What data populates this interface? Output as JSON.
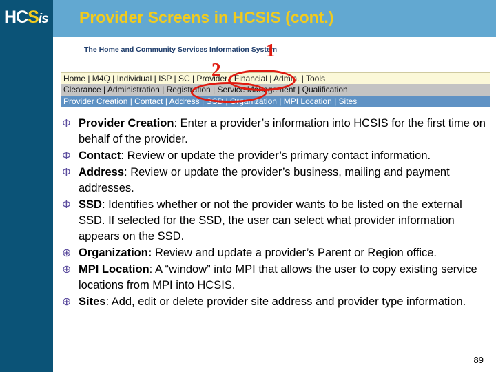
{
  "slide": {
    "title": "Provider Screens in HCSIS (cont.)",
    "number": "89",
    "colors": {
      "sidebar": "#0b5377",
      "header_bar": "#62a8d1",
      "title_text": "#f2cb1d",
      "annotation_red": "#e01b10",
      "bullet_purple": "#5b4c9e",
      "nav_row1_bg": "#fbf8d8",
      "nav_row2_bg": "#c3c3c3",
      "nav_row3_bg": "#5f92c4"
    }
  },
  "logo": {
    "part1": "HC",
    "part2": "S",
    "part3": "is"
  },
  "app": {
    "subtitle": "The Home and Community Services Information System",
    "nav_row1": "Home |  M4Q  |  Individual  |  ISP  |  SC  |  Provider  |  Financial  |  Admin.  |  Tools",
    "nav_row2": "Clearance |   Administration  |  Registration  |  Service Management  |  Qualification",
    "nav_row3": "Provider Creation  |  Contact  |  Address  |  SSD  |  Organization  |  MPI Location  |  Sites"
  },
  "annotations": {
    "marker_1": "1",
    "marker_2": "2",
    "circle_1_target": "Provider",
    "circle_2_target": "Registration"
  },
  "bullets": [
    {
      "glyph": "Φ",
      "term": "Provider Creation",
      "separator": ": ",
      "body": "Enter a provider’s information into HCSIS for the first time on behalf of the provider."
    },
    {
      "glyph": "Φ",
      "term": "Contact",
      "separator": ": ",
      "body": "Review or update the provider’s primary contact information."
    },
    {
      "glyph": "Φ",
      "term": "Address",
      "separator": ": ",
      "body": "Review or update the provider’s business, mailing and payment addresses."
    },
    {
      "glyph": "Φ",
      "term": "SSD",
      "separator": ": ",
      "body": "Identifies whether or not the provider wants to be listed on the external SSD. If selected for the SSD, the user can select what provider information appears on the SSD."
    },
    {
      "glyph": "⊕",
      "term": "Organization:",
      "separator": " ",
      "body": "Review and update a provider’s Parent or Region office."
    },
    {
      "glyph": "⊕",
      "term": "MPI Location",
      "separator": ": ",
      "body": "A “window” into MPI that allows the user to copy existing service locations from MPI into HCSIS."
    },
    {
      "glyph": "⊕",
      "term": "Sites",
      "separator": ": ",
      "body": "Add, edit or delete provider site address and provider type information."
    }
  ]
}
